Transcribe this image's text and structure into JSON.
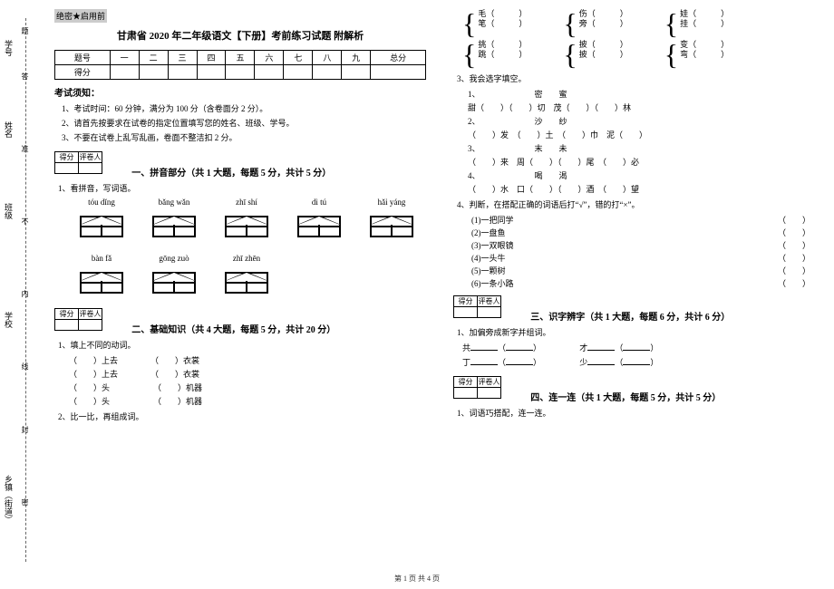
{
  "sidebar": {
    "fields": [
      "学号",
      "姓名",
      "班级",
      "学校",
      "乡镇（街道）"
    ],
    "markers": [
      "题",
      "答",
      "准",
      "不",
      "内",
      "线",
      "封",
      "密"
    ]
  },
  "secret": "绝密★启用前",
  "title": "甘肃省 2020 年二年级语文【下册】考前练习试题 附解析",
  "score_headers": [
    "题号",
    "一",
    "二",
    "三",
    "四",
    "五",
    "六",
    "七",
    "八",
    "九",
    "总分"
  ],
  "score_row_label": "得分",
  "notice": {
    "title": "考试须知：",
    "items": [
      "1、考试时间：60 分钟，满分为 100 分（含卷面分 2 分）。",
      "2、请首先按要求在试卷的指定位置填写您的姓名、班级、学号。",
      "3、不要在试卷上乱写乱画，卷面不整洁扣 2 分。"
    ]
  },
  "scorebox": {
    "l": "得分",
    "r": "评卷人"
  },
  "sections": {
    "s1": "一、拼音部分（共 1 大题，每题 5 分，共计 5 分）",
    "s2": "二、基础知识（共 4 大题，每题 5 分，共计 20 分）",
    "s3": "三、识字辨字（共 1 大题，每题 6 分，共计 6 分）",
    "s4": "四、连一连（共 1 大题，每题 5 分，共计 5 分）"
  },
  "q1": {
    "stem": "1、看拼音，写词语。",
    "pinyin": [
      "tóu dǐng",
      "bǎng wǎn",
      "zhī shí",
      "dì tú",
      "hǎi yáng",
      "bàn fǎ",
      "gōng zuò",
      "zhī zhēn"
    ]
  },
  "q2_1": {
    "stem": "1、填上不同的动词。",
    "rows": [
      [
        "（　　）上去",
        "（　　）衣裳"
      ],
      [
        "（　　）上去",
        "（　　）衣裳"
      ],
      [
        "（　　）头",
        "（　　）机器"
      ],
      [
        "（　　）头",
        "（　　）机器"
      ]
    ]
  },
  "q2_2": {
    "stem": "2、比一比，再组成词。"
  },
  "brace_groups": [
    [
      [
        "毛（　　　）",
        "笔（　　　）"
      ],
      [
        "伤（　　　）",
        "旁（　　　）"
      ],
      [
        "娃（　　　）",
        "挂（　　　）"
      ]
    ],
    [
      [
        "挑（　　　）",
        "跳（　　　）"
      ],
      [
        "披（　　　）",
        "披（　　　）"
      ],
      [
        "变（　　　）",
        "弯（　　　）"
      ]
    ]
  ],
  "q2_3": {
    "stem": "3、我会选字填空。",
    "groups": [
      {
        "no": "1、",
        "chars": "密　　蜜",
        "line": "甜（　　）（　　）切　茂（　　）（　　）林"
      },
      {
        "no": "2、",
        "chars": "沙　　纱",
        "line": "（　　）发　（　　）土　（　　）巾　泥（　　）"
      },
      {
        "no": "3、",
        "chars": "末　　未",
        "line": "（　　）来　周（　　）（　　）尾　（　　）必"
      },
      {
        "no": "4、",
        "chars": "喝　　渴",
        "line": "（　　）水　口（　　）（　　）酒　（　　）望"
      }
    ]
  },
  "q2_4": {
    "stem": "4、判断，在搭配正确的词语后打“√”，错的打“×”。",
    "items": [
      "(1)一把同学",
      "(2)一盘鱼",
      "(3)一双眼镜",
      "(4)一头牛",
      "(5)一颗树",
      "(6)一条小路"
    ]
  },
  "q3_1": {
    "stem": "1、加偏旁成新字并组词。",
    "rows": [
      {
        "a": "共",
        "b": "才"
      },
      {
        "a": "丁",
        "b": "少"
      }
    ]
  },
  "q4_1": {
    "stem": "1、词语巧搭配，连一连。"
  },
  "footer": "第 1 页 共 4 页"
}
